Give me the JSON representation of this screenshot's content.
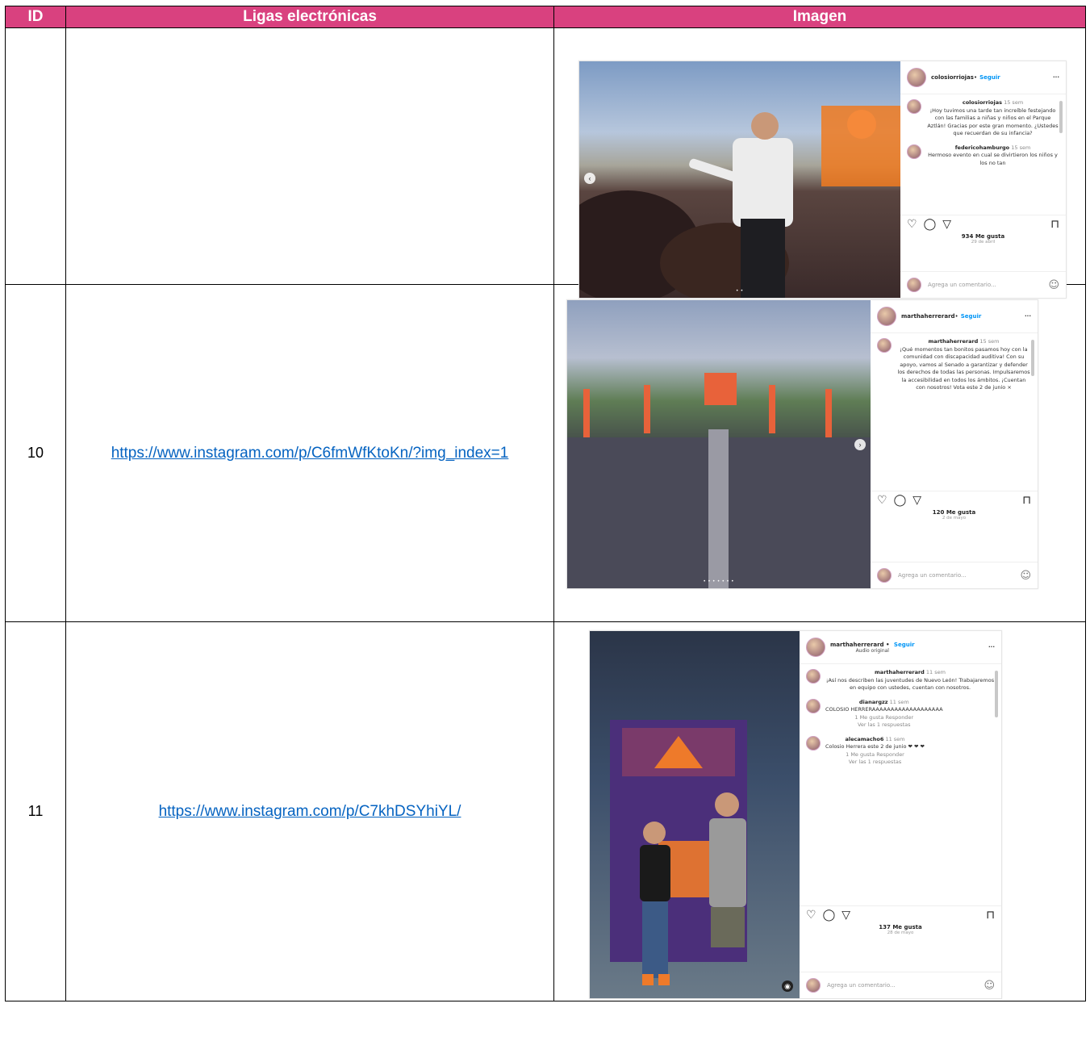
{
  "table": {
    "headers": [
      "ID",
      "Ligas electrónicas",
      "Imagen"
    ],
    "rows": [
      {
        "id": "",
        "link": ""
      },
      {
        "id": "10",
        "link": "https://www.instagram.com/p/C6fmWfKtoKn/?img_index=1"
      },
      {
        "id": "11",
        "link": "https://www.instagram.com/p/C7khDSYhiYL/"
      }
    ]
  },
  "posts": [
    {
      "user": "colosiorriojas",
      "follow": "Seguir",
      "comments": [
        {
          "user": "colosiorriojas",
          "time": "15 sem",
          "text": "¡Hoy tuvimos una tarde tan increíble festejando con las familias a niñas y niños en el Parque Aztlán! Gracias por este gran momento. ¿Ustedes que recuerdan de su infancia?"
        },
        {
          "user": "federicohamburgo",
          "time": "15 sem",
          "text": "Hermoso evento en cual se divirtieron los niños y los no tan"
        }
      ],
      "likes": "934 Me gusta",
      "date": "29 de abril",
      "add_comment": "Agrega un comentario...",
      "colors": {
        "sky": "#7d9bc4",
        "crowd": "#3a2a2a",
        "accent": "#f07a20"
      }
    },
    {
      "user": "marthaherrerard",
      "follow": "Seguir",
      "comments": [
        {
          "user": "marthaherrerard",
          "time": "15 sem",
          "text": "¡Qué momentos tan bonitos pasamos hoy con la comunidad con discapacidad auditiva! Con su apoyo, vamos al Senado a garantizar y defender los derechos de todas las personas. Impulsaremos la accesibilidad en todos los ámbitos. ¡Cuentan con nosotros! Vota este 2 de junio ×"
        }
      ],
      "likes": "120 Me gusta",
      "date": "2 de mayo",
      "add_comment": "Agrega un comentario...",
      "colors": {
        "sky": "#8fa0be",
        "crowd": "#3b3b46",
        "accent": "#e8623a"
      }
    },
    {
      "user": "marthaherrerard",
      "follow": "Seguir",
      "subtitle": "Audio original",
      "comments": [
        {
          "user": "marthaherrerard",
          "time": "11 sem",
          "text": "¡Así nos describen las juventudes de Nuevo León! Trabajaremos en equipo con ustedes, cuentan con nosotros."
        },
        {
          "user": "dianargzz",
          "time": "11 sem",
          "text": "COLOSIO HERRERAAAAAAAAAAAAAAAAAAA",
          "meta": "1 Me gusta   Responder",
          "replies": "Ver las 1 respuestas"
        },
        {
          "user": "alecamacho6",
          "time": "11 sem",
          "text": "Colosio Herrera este 2 de junio ❤ ❤ ❤",
          "meta": "1 Me gusta   Responder",
          "replies": "Ver las 1 respuestas"
        }
      ],
      "likes": "137 Me gusta",
      "date": "28 de mayo",
      "add_comment": "Agrega un comentario...",
      "colors": {
        "bg": "#3b4e6a",
        "banner": "#4b2f7a",
        "accent": "#ee7a2a"
      }
    }
  ]
}
